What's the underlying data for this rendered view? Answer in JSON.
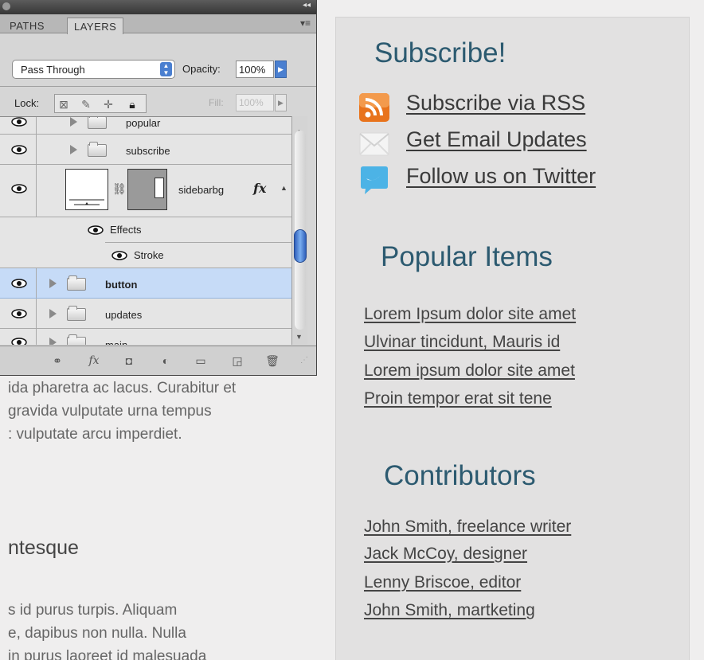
{
  "panel": {
    "tabs": [
      "PATHS",
      "LAYERS"
    ],
    "blend_mode": "Pass Through",
    "opacity_label": "Opacity:",
    "opacity_value": "100%",
    "lock_label": "Lock:",
    "fill_label": "Fill:",
    "fill_value": "100%",
    "layers": [
      {
        "name": "popular",
        "type": "group"
      },
      {
        "name": "subscribe",
        "type": "group"
      },
      {
        "name": "sidebarbg",
        "type": "layer",
        "fx": "fx"
      },
      {
        "name": "Effects",
        "type": "effects"
      },
      {
        "name": "Stroke",
        "type": "effect"
      },
      {
        "name": "button",
        "type": "group",
        "selected": true
      },
      {
        "name": "updates",
        "type": "group"
      },
      {
        "name": "main",
        "type": "group"
      }
    ],
    "bottom_icons": [
      "link-layers-icon",
      "fx-icon",
      "add-mask-icon",
      "adjustment-layer-icon",
      "new-group-icon",
      "new-layer-icon",
      "trash-icon"
    ],
    "fx_icon_label": "fx"
  },
  "page": {
    "body_lines_top": [
      "ida pharetra ac lacus. Curabitur et",
      " gravida vulputate urna tempus",
      ": vulputate arcu imperdiet."
    ],
    "heading": "ntesque",
    "body_lines_bottom": [
      "s id purus turpis. Aliquam",
      "e, dapibus non nulla. Nulla",
      " in purus laoreet id malesuada"
    ]
  },
  "sidebar": {
    "subscribe_heading": "Subscribe!",
    "subscribe_links": [
      {
        "label": "Subscribe via RSS",
        "icon": "rss-icon"
      },
      {
        "label": "Get Email Updates",
        "icon": "email-icon"
      },
      {
        "label": "Follow us on Twitter",
        "icon": "twitter-icon"
      }
    ],
    "popular_heading": "Popular Items",
    "popular_items": [
      "Lorem Ipsum dolor site amet",
      "Ulvinar tincidunt, Mauris id",
      "Lorem ipsum dolor site amet",
      "Proin tempor erat sit tene"
    ],
    "contributors_heading": "Contributors",
    "contributors": [
      "John Smith, freelance writer",
      "Jack McCoy, designer",
      "Lenny Briscoe, editor",
      "John Smith, martketing"
    ]
  },
  "colors": {
    "heading": "#2c5a70",
    "selected_layer": "#c6dbf7",
    "rss": "#e8731c",
    "twitter": "#4cb3e6"
  }
}
